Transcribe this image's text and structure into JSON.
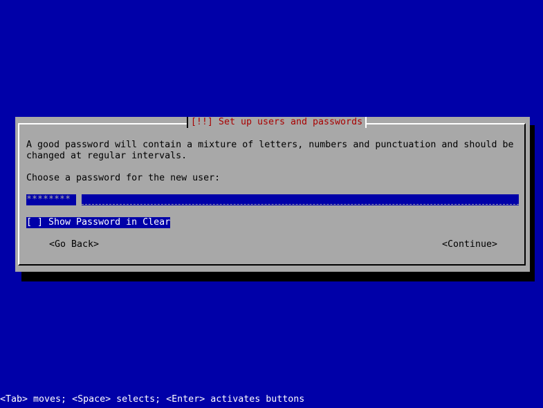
{
  "dialog": {
    "title": "[!!] Set up users and passwords",
    "description": "A good password will contain a mixture of letters, numbers and punctuation and should be changed at regular intervals.",
    "prompt": "Choose a password for the new user:",
    "password_value": "********",
    "show_password_label": "[ ] Show Password in Clear",
    "go_back_label": "<Go Back>",
    "continue_label": "<Continue>"
  },
  "status_bar": {
    "text": "<Tab> moves; <Space> selects; <Enter> activates buttons"
  },
  "colors": {
    "background": "#0000a8",
    "dialog": "#a8a8a8",
    "title": "#a80000",
    "shadow": "#000000"
  }
}
